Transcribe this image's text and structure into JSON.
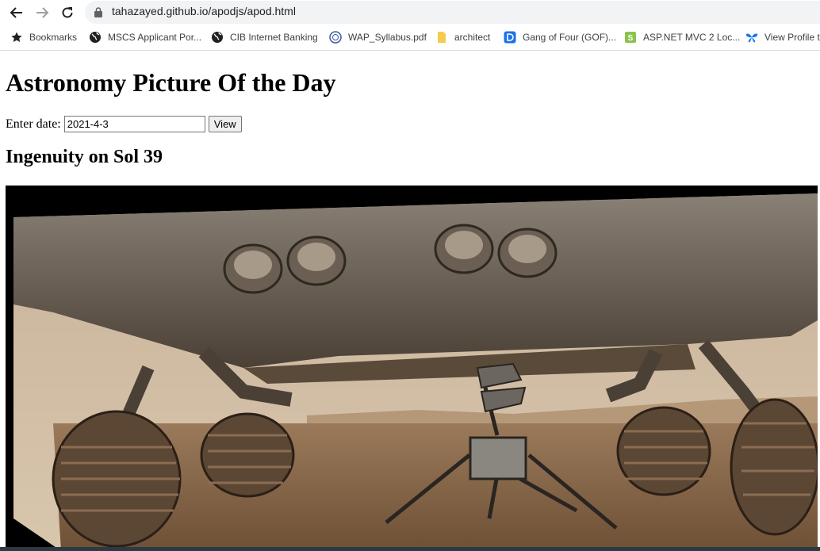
{
  "browser": {
    "url": "tahazayed.github.io/apodjs/apod.html",
    "bookmarks": [
      {
        "label": "Bookmarks",
        "icon": "star-icon"
      },
      {
        "label": "MSCS Applicant Por...",
        "icon": "globe-icon"
      },
      {
        "label": "CIB Internet Banking",
        "icon": "globe-icon"
      },
      {
        "label": "WAP_Syllabus.pdf",
        "icon": "seal-icon"
      },
      {
        "label": "architect",
        "icon": "folder-icon"
      },
      {
        "label": "Gang of Four (GOF)...",
        "icon": "d-logo-icon"
      },
      {
        "label": "ASP.NET MVC 2 Loc...",
        "icon": "s-logo-icon"
      },
      {
        "label": "View Profile t",
        "icon": "butterfly-icon"
      }
    ]
  },
  "page": {
    "title": "Astronomy Picture Of the Day",
    "date_label": "Enter date:",
    "date_value": "2021-4-3",
    "view_button": "View",
    "apod_title": "Ingenuity on Sol 39"
  },
  "colors": {
    "accent_blue": "#1a73e8",
    "folder_yellow": "#f7cb4d",
    "s_logo_green": "#8bc34a"
  }
}
